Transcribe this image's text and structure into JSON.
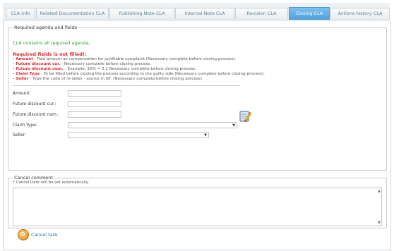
{
  "tabs": [
    {
      "label": "CLA info"
    },
    {
      "label": "Related Documentation CLA"
    },
    {
      "label": "Publishing Note CLA"
    },
    {
      "label": "Internal Note CLA"
    },
    {
      "label": "Revision CLA"
    },
    {
      "label": "Closing CLA",
      "active": true
    },
    {
      "label": "Actions history CLA"
    }
  ],
  "required": {
    "legend": "Required agenda and fields",
    "agenda_status": "CLA contains all required agenda.",
    "missing_title": "Required fields is not filled!:",
    "missing": [
      {
        "field": "- Amount",
        "text": " - Paid amount as compensation for justifiable complaint (Necessary complete before closing process)."
      },
      {
        "field": "- Future discount cur.",
        "text": " - Necessary complete before closing process."
      },
      {
        "field": "- Future discount num.",
        "text": " - Example: 10% = 0.1 Necessary complete before closing process."
      },
      {
        "field": "- Claim Type",
        "text": " - To be filled before closing the process according to the guilty side (Necessary complete before closing process)."
      },
      {
        "field": "- Seller",
        "text": " - Type the code of re-seller - source in GT. (Necessary complete before closing process)."
      }
    ]
  },
  "form": {
    "amount_label": "Amount:",
    "amount_value": "",
    "future_cur_label": "Future discount cur.:",
    "future_cur_value": "",
    "future_num_label": "Future discount num.:",
    "future_num_value": "",
    "claim_type_label": "Claim Type:",
    "claim_type_value": "",
    "seller_label": "Seller:",
    "seller_value": ""
  },
  "cancel": {
    "legend": "Cancel comment",
    "note": "* Cancel Date will be set automatically.",
    "comment_value": "",
    "button_label": "Cancel task"
  },
  "icons": {
    "edit": "edit-document-icon",
    "cancel": "cancel-circle-icon",
    "dropdown": "chevron-down-icon"
  },
  "colors": {
    "active_tab": "#4c9fdc",
    "ok_text": "#2e9b2e",
    "error_text": "#e3262a",
    "link": "#2f6fa8"
  }
}
